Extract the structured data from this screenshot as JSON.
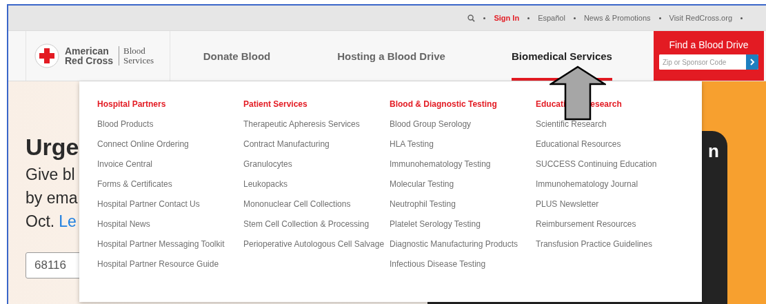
{
  "top_links": [
    {
      "kind": "search"
    },
    {
      "kind": "highlight",
      "label": "Sign In"
    },
    {
      "kind": "link",
      "label": "Español"
    },
    {
      "kind": "link",
      "label": "News & Promotions"
    },
    {
      "kind": "link",
      "label": "Visit RedCross.org"
    }
  ],
  "logo": {
    "name_lines": [
      "American",
      "Red Cross"
    ],
    "division_lines": [
      "Blood",
      "Services"
    ]
  },
  "nav_tabs": [
    {
      "label": "Donate Blood",
      "selected": false
    },
    {
      "label": "Hosting a Blood Drive",
      "selected": false
    },
    {
      "label": "Biomedical Services",
      "selected": true
    }
  ],
  "cta": {
    "title": "Find a Blood Drive",
    "placeholder": "Zip or Sponsor Code"
  },
  "hero": {
    "headline": "Urge",
    "lines": [
      "Give bl",
      "by ema"
    ],
    "last_line": {
      "text": "Oct.",
      "link": "Le"
    },
    "zip_value": "68116",
    "card_text": "n"
  },
  "menu": {
    "columns": [
      {
        "heading_parts": [
          "Hospital Partners"
        ],
        "items": [
          "Blood Products",
          "Connect Online Ordering",
          "Invoice Central",
          "Forms & Certificates",
          "Hospital Partner Contact Us",
          "Hospital News",
          "Hospital Partner Messaging Toolkit",
          "Hospital Partner Resource Guide"
        ]
      },
      {
        "heading_parts": [
          "Patient Services"
        ],
        "items": [
          "Therapeutic Apheresis Services",
          "Contract Manufacturing",
          "Granulocytes",
          "Leukopacks",
          "Mononuclear Cell Collections",
          "Stem Cell Collection & Processing",
          "Perioperative Autologous Cell Salvage"
        ]
      },
      {
        "heading_parts": [
          "Blood & Diagnostic Testing"
        ],
        "items": [
          "Blood Group Serology",
          "HLA Testing",
          "Immunohematology Testing",
          "Molecular Testing",
          "Neutrophil Testing",
          "Platelet Serology Testing",
          "Diagnostic Manufacturing Products",
          "Infectious Disease Testing"
        ]
      },
      {
        "heading_parts": [
          "Educati",
          "esearch"
        ],
        "items": [
          "Scientific Research",
          "Educational Resources",
          "SUCCESS Continuing Education",
          "Immunohematology Journal",
          "PLUS Newsletter",
          "Reimbursement Resources",
          "Transfusion Practice Guidelines"
        ]
      }
    ]
  }
}
